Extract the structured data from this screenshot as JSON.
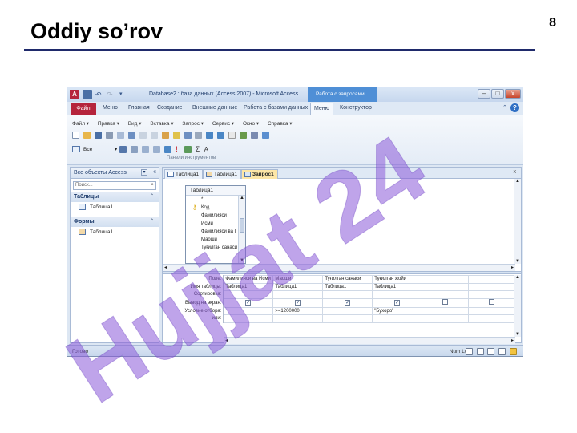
{
  "slide": {
    "title": "Oddiy so’rov",
    "page_number": "8",
    "watermark": "Hujjat 24"
  },
  "window": {
    "title": "Database2 : база данных (Access 2007) - Microsoft Access",
    "context_tab": "Работа с запросами",
    "controls": {
      "minimize": "–",
      "maximize": "□",
      "close": "x"
    }
  },
  "ribbon_tabs": [
    "Главная",
    "Создание",
    "Внешние данные",
    "Работа с базами данных",
    "Меню",
    "Конструктор"
  ],
  "file_tab": "Файл",
  "menu_tab": "Меню",
  "menubar": [
    "Файл ▾",
    "Правка ▾",
    "Вид ▾",
    "Вставка ▾",
    "Запрос ▾",
    "Сервис ▾",
    "Окно ▾",
    "Справка ▾"
  ],
  "toolbar": {
    "select_all": "Все",
    "panel_caption": "Панели инструментов"
  },
  "nav": {
    "header": "Все объекты Access",
    "search_placeholder": "Поиск...",
    "groups": [
      {
        "name": "Таблицы",
        "items": [
          "Таблица1"
        ]
      },
      {
        "name": "Формы",
        "items": [
          "Таблица1"
        ]
      }
    ]
  },
  "doc_tabs": [
    "Таблица1",
    "Таблица1",
    "Запрос1"
  ],
  "doc_close": "x",
  "field_list": {
    "title": "Таблица1",
    "fields": [
      "*",
      "Код",
      "Фамилияси",
      "Исми",
      "Фамилияси ва I",
      "Маоши",
      "Туғилган санаси"
    ]
  },
  "query_grid": {
    "row_labels": [
      "Поле:",
      "Имя таблицы:",
      "Сортировка:",
      "Вывод на экран:",
      "Условие отбора:",
      "или:"
    ],
    "columns": [
      {
        "field": "Фамилияси ва Исми",
        "table": "Таблица1",
        "show": true,
        "criteria": ""
      },
      {
        "field": "Маоши",
        "table": "Таблица1",
        "show": true,
        "criteria": ">=1200000"
      },
      {
        "field": "Туғилган санаси",
        "table": "Таблица1",
        "show": true,
        "criteria": ""
      },
      {
        "field": "Туғилган жойи",
        "table": "Таблица1",
        "show": true,
        "criteria": "\"Бухоро\""
      },
      {
        "field": "",
        "table": "",
        "show": false,
        "criteria": ""
      },
      {
        "field": "",
        "table": "",
        "show": false,
        "criteria": ""
      }
    ]
  },
  "status": {
    "left": "Готово",
    "right": "Num Lock"
  },
  "colors": {
    "file_tab": "#b5243c",
    "context_tab": "#4f8fd6",
    "watermark": "#8a5ad8",
    "title_rule": "#1f2a6b"
  }
}
